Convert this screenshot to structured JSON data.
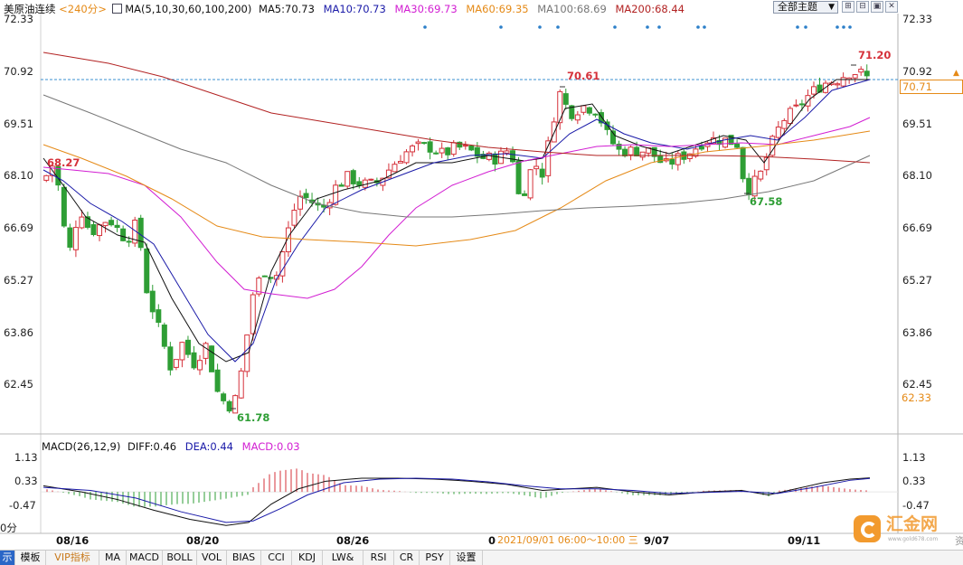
{
  "header": {
    "symbol": "美原油连续",
    "period": "<240分>",
    "ma_params": "MA(5,10,30,60,100,200)",
    "ma5": "MA5:70.73",
    "ma10": "MA10:70.73",
    "ma30": "MA30:69.73",
    "ma60": "MA60:69.35",
    "ma100": "MA100:68.69",
    "ma200": "MA200:68.44",
    "theme_button": "全部主题"
  },
  "price_axis": {
    "ticks": [
      "72.33",
      "70.92",
      "69.51",
      "68.10",
      "66.69",
      "65.27",
      "63.86",
      "62.45"
    ],
    "current_price_tag": "70.71",
    "low_tag": "62.33"
  },
  "annotations": {
    "high_label": "71.20",
    "peak_label": "70.61",
    "left_label": "68.27",
    "low_label": "61.78",
    "dip_label": "67.58"
  },
  "macd": {
    "header": "MACD(26,12,9)",
    "diff": "DIFF:0.46",
    "dea": "DEA:0.44",
    "macd": "MACD:0.03",
    "ticks": [
      "1.13",
      "0.33",
      "-0.47"
    ],
    "left_cut_tick": "0分"
  },
  "x_axis": {
    "ticks": [
      "08/16",
      "08/20",
      "08/26",
      "0",
      "9/07",
      "09/11"
    ],
    "cursor_time": "2021/09/01 06:00～10:00 三"
  },
  "tabs": [
    "示",
    "模板",
    "VIP指标",
    "MA",
    "MACD",
    "BOLL",
    "VOL",
    "BIAS",
    "CCI",
    "KDJ",
    "LW&",
    "RSI",
    "CR",
    "PSY",
    "设置"
  ],
  "watermark": {
    "brand": "汇金网",
    "url": "www.gold678.com",
    "edge": "资"
  },
  "colors": {
    "up": "#d5313a",
    "down": "#2e9e35",
    "ma5": "#111111",
    "ma10": "#1a1aa8",
    "ma30": "#d21ed2",
    "ma60": "#e58a17",
    "ma100": "#777777",
    "ma200": "#b22222"
  },
  "chart_data": {
    "type": "line",
    "price_ylim": [
      61.5,
      72.5
    ],
    "series": [
      {
        "name": "MA5:70.73",
        "x": [
          "08/16",
          "08/20",
          "08/26",
          "09/07",
          "09/11"
        ],
        "values": [
          68.0,
          62.6,
          67.9,
          69.1,
          70.73
        ]
      },
      {
        "name": "MA10:70.73",
        "x": [
          "08/16",
          "08/20",
          "08/26",
          "09/07",
          "09/11"
        ],
        "values": [
          68.5,
          62.9,
          67.4,
          69.0,
          70.73
        ]
      },
      {
        "name": "MA30:69.73",
        "x": [
          "08/16",
          "08/20",
          "08/26",
          "09/07",
          "09/11"
        ],
        "values": [
          68.3,
          65.4,
          66.5,
          68.9,
          69.73
        ]
      },
      {
        "name": "MA60:69.35",
        "x": [
          "08/16",
          "08/20",
          "08/26",
          "09/07",
          "09/11"
        ],
        "values": [
          69.0,
          66.9,
          66.2,
          68.4,
          69.35
        ]
      },
      {
        "name": "MA100:68.69",
        "x": [
          "08/16",
          "08/20",
          "08/26",
          "09/07",
          "09/11"
        ],
        "values": [
          70.3,
          68.7,
          67.2,
          67.6,
          68.69
        ]
      },
      {
        "name": "MA200:68.44",
        "x": [
          "08/16",
          "08/20",
          "08/26",
          "09/07",
          "09/11"
        ],
        "values": [
          71.6,
          70.7,
          69.7,
          68.8,
          68.44
        ]
      }
    ],
    "key_prices": {
      "high": 71.2,
      "low": 61.78,
      "current": 70.71
    },
    "macd_ylim": [
      -1.3,
      1.6
    ]
  }
}
